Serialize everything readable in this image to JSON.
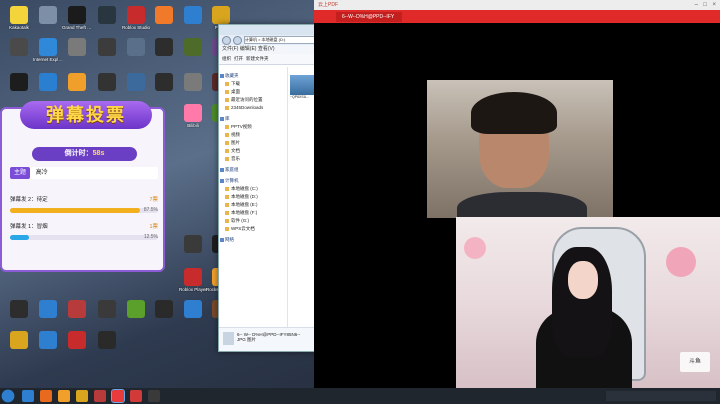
{
  "desktop": {
    "icons": [
      {
        "label": "Kakaotalk",
        "color": "#f3d43a"
      },
      {
        "label": "",
        "color": "#7c8fa6"
      },
      {
        "label": "Grand Theft Auto V",
        "color": "#1b1b1b"
      },
      {
        "label": "",
        "color": "#29353f"
      },
      {
        "label": "Roblox Studio",
        "color": "#c72b2b"
      },
      {
        "label": "",
        "color": "#f07a2a"
      },
      {
        "label": "",
        "color": "#2f7fd1"
      },
      {
        "label": "PUBG",
        "color": "#d9a51f"
      },
      {
        "label": "",
        "color": "#4a4a4a"
      },
      {
        "label": "Internet Explorer",
        "color": "#2f88d8"
      },
      {
        "label": "",
        "color": "#7a7a7a"
      },
      {
        "label": "",
        "color": "#3c3c3c"
      },
      {
        "label": "",
        "color": "#5a6f8a"
      },
      {
        "label": "",
        "color": "#2d2d2d"
      },
      {
        "label": "",
        "color": "#4e6b2a"
      },
      {
        "label": "",
        "color": "#6a4a8a"
      },
      {
        "label": "",
        "color": "#1d1d1d"
      },
      {
        "label": "",
        "color": "#2a7fd1"
      },
      {
        "label": "",
        "color": "#f0a02a"
      },
      {
        "label": "",
        "color": "#333333"
      },
      {
        "label": "",
        "color": "#3c6a9c"
      },
      {
        "label": "",
        "color": "#2d2d2d"
      },
      {
        "label": "",
        "color": "#7a7a7a"
      },
      {
        "label": "",
        "color": "#5a2a2a"
      },
      {
        "label": "Bilibili",
        "color": "#ff7aa8"
      },
      {
        "label": "",
        "color": "#4e8c2a"
      },
      {
        "label": "",
        "color": "#3a3a3a"
      },
      {
        "label": "",
        "color": "#1d1d1d"
      },
      {
        "label": "Roblox Player",
        "color": "#c72b2b"
      },
      {
        "label": "Rockstar Games Launcher",
        "color": "#f0a02a"
      },
      {
        "label": "",
        "color": "#2d2d2d"
      },
      {
        "label": "",
        "color": "#2f7fd1"
      },
      {
        "label": "",
        "color": "#b83b3b"
      },
      {
        "label": "",
        "color": "#3a3a3a"
      },
      {
        "label": "",
        "color": "#5aa02a"
      },
      {
        "label": "",
        "color": "#2a2a2a"
      },
      {
        "label": "",
        "color": "#2f7fd1"
      },
      {
        "label": "",
        "color": "#7a4a2a"
      },
      {
        "label": "",
        "color": "#d9a51f"
      },
      {
        "label": "",
        "color": "#2f7fd1"
      },
      {
        "label": "",
        "color": "#c72b2b"
      },
      {
        "label": "",
        "color": "#2a2a2a"
      }
    ]
  },
  "explorer": {
    "address": "计算机 > 本地磁盘 (D:)",
    "menu": "文件(F)  编辑(E)  查看(V)",
    "toolbar": [
      "组织",
      "打开",
      "新建文件夹"
    ],
    "nav": [
      {
        "label": "收藏夹",
        "group": true
      },
      {
        "label": "下载"
      },
      {
        "label": "桌面"
      },
      {
        "label": "最近访问的位置"
      },
      {
        "label": "2345Downloads"
      },
      {
        "label": "库",
        "group": true
      },
      {
        "label": "PPTV视频"
      },
      {
        "label": "视频"
      },
      {
        "label": "图片"
      },
      {
        "label": "文档"
      },
      {
        "label": "音乐"
      },
      {
        "label": "家庭组",
        "group": true
      },
      {
        "label": "计算机",
        "group": true
      },
      {
        "label": "本地磁盘 (C:)"
      },
      {
        "label": "本地磁盘 (D:)"
      },
      {
        "label": "本地磁盘 (E:)"
      },
      {
        "label": "本地磁盘 (F:)"
      },
      {
        "label": "软件 (G:)"
      },
      {
        "label": "WPS云文档"
      },
      {
        "label": "网络",
        "group": true
      }
    ],
    "file_caption": "~QP6XSU...",
    "details_name": "6-- W-- D%H@PPD--IFY85N6--",
    "details_type": "JPG 图片"
  },
  "video_window": {
    "app_title": "云上PDF",
    "tab_label": "6--W--D%H@PPD--IFY"
  },
  "vote": {
    "title": "弹幕投票",
    "countdown_label": "倒计时：",
    "countdown_value": "58s",
    "topic_tag": "主题",
    "topic_text": "高冷",
    "options": [
      {
        "label": "弹幕发 2：待定",
        "count": "7票",
        "percent": "87.5%",
        "value": 87.5,
        "color": "#f2b01e"
      },
      {
        "label": "弹幕发 1：冒烟",
        "count": "1票",
        "percent": "12.5%",
        "value": 12.5,
        "color": "#2aa7e6"
      }
    ]
  },
  "taskbar": {
    "apps": [
      {
        "color": "#2f7fd1"
      },
      {
        "color": "#e86a1e"
      },
      {
        "color": "#f0a02a"
      },
      {
        "color": "#d9a51f"
      },
      {
        "color": "#b83b3b"
      },
      {
        "color": "#e83b3b",
        "active": true
      },
      {
        "color": "#d23a3a"
      },
      {
        "color": "#3a3a3a"
      }
    ]
  }
}
